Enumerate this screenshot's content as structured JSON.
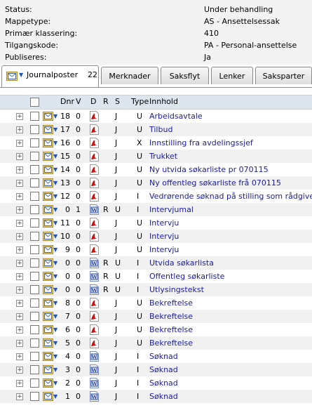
{
  "meta": [
    {
      "key": "Status:",
      "value": "Under behandling"
    },
    {
      "key": "Mappetype:",
      "value": "AS - Ansettelsessak"
    },
    {
      "key": "Primær klassering:",
      "value": "410"
    },
    {
      "key": "Tilgangskode:",
      "value": "PA - Personal-ansettelse"
    },
    {
      "key": "Publiseres:",
      "value": "Ja"
    }
  ],
  "tabs": {
    "journalposter": {
      "label": "Journalposter",
      "count": "22"
    },
    "merknader": "Merknader",
    "saksflyt": "Saksflyt",
    "lenker": "Lenker",
    "saksparter": "Saksparter"
  },
  "columns": {
    "dnr": "Dnr",
    "v": "V",
    "d": "D",
    "r": "R",
    "s": "S",
    "type": "Type",
    "innhold": "Innhold"
  },
  "rows": [
    {
      "dnr": "18",
      "v": "0",
      "doc": "pdf",
      "r": "",
      "s": "J",
      "type": "U",
      "innhold": "Arbeidsavtale"
    },
    {
      "dnr": "17",
      "v": "0",
      "doc": "pdf",
      "r": "",
      "s": "J",
      "type": "U",
      "innhold": "Tilbud"
    },
    {
      "dnr": "16",
      "v": "0",
      "doc": "pdf",
      "r": "",
      "s": "J",
      "type": "X",
      "innhold": "Innstilling fra avdelingssjef"
    },
    {
      "dnr": "15",
      "v": "0",
      "doc": "pdf",
      "r": "",
      "s": "J",
      "type": "U",
      "innhold": "Trukket"
    },
    {
      "dnr": "14",
      "v": "0",
      "doc": "pdf",
      "r": "",
      "s": "J",
      "type": "U",
      "innhold": "Ny utvida søkarliste pr 070115"
    },
    {
      "dnr": "13",
      "v": "0",
      "doc": "pdf",
      "r": "",
      "s": "J",
      "type": "U",
      "innhold": "Ny offentleg søkarliste frå 070115"
    },
    {
      "dnr": "12",
      "v": "0",
      "doc": "pdf",
      "r": "",
      "s": "J",
      "type": "I",
      "innhold": "Vedrørende søknad på stilling som rådgiver"
    },
    {
      "dnr": "0",
      "v": "1",
      "doc": "word",
      "r": "R",
      "s": "U",
      "type": "I",
      "innhold": "Intervjumal"
    },
    {
      "dnr": "11",
      "v": "0",
      "doc": "pdf",
      "r": "",
      "s": "J",
      "type": "U",
      "innhold": "Intervju"
    },
    {
      "dnr": "10",
      "v": "0",
      "doc": "pdf",
      "r": "",
      "s": "J",
      "type": "U",
      "innhold": "Intervju"
    },
    {
      "dnr": "9",
      "v": "0",
      "doc": "pdf",
      "r": "",
      "s": "J",
      "type": "U",
      "innhold": "Intervju"
    },
    {
      "dnr": "0",
      "v": "0",
      "doc": "word",
      "r": "R",
      "s": "U",
      "type": "I",
      "innhold": "Utvida søkarlista"
    },
    {
      "dnr": "0",
      "v": "0",
      "doc": "word",
      "r": "R",
      "s": "U",
      "type": "I",
      "innhold": "Offentleg søkarliste"
    },
    {
      "dnr": "0",
      "v": "0",
      "doc": "word",
      "r": "R",
      "s": "U",
      "type": "I",
      "innhold": "Utlysingstekst"
    },
    {
      "dnr": "8",
      "v": "0",
      "doc": "pdf",
      "r": "",
      "s": "J",
      "type": "U",
      "innhold": "Bekreftelse"
    },
    {
      "dnr": "7",
      "v": "0",
      "doc": "pdf",
      "r": "",
      "s": "J",
      "type": "U",
      "innhold": "Bekreftelse"
    },
    {
      "dnr": "6",
      "v": "0",
      "doc": "pdf",
      "r": "",
      "s": "J",
      "type": "U",
      "innhold": "Bekreftelse"
    },
    {
      "dnr": "5",
      "v": "0",
      "doc": "pdf",
      "r": "",
      "s": "J",
      "type": "U",
      "innhold": "Bekreftelse"
    },
    {
      "dnr": "4",
      "v": "0",
      "doc": "word",
      "r": "",
      "s": "J",
      "type": "I",
      "innhold": "Søknad"
    },
    {
      "dnr": "3",
      "v": "0",
      "doc": "word",
      "r": "",
      "s": "J",
      "type": "I",
      "innhold": "Søknad"
    },
    {
      "dnr": "2",
      "v": "0",
      "doc": "word",
      "r": "",
      "s": "J",
      "type": "I",
      "innhold": "Søknad"
    },
    {
      "dnr": "1",
      "v": "0",
      "doc": "word",
      "r": "",
      "s": "J",
      "type": "I",
      "innhold": "Søknad"
    }
  ],
  "icons": {
    "expander": "+",
    "dropdown": "▼",
    "word_letter": "W"
  },
  "colors": {
    "link": "#1a1aa6",
    "pdf": "#cc1111",
    "word": "#1f3f9f",
    "header_bg": "#dde6ef"
  }
}
